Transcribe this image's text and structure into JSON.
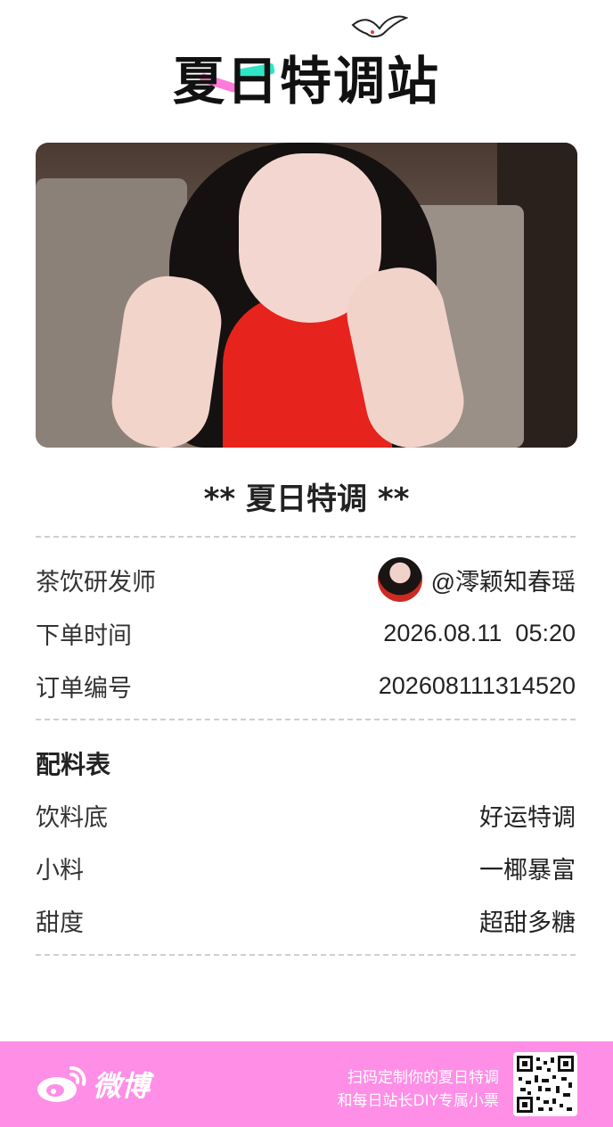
{
  "logo": {
    "text": "夏日特调站"
  },
  "receipt": {
    "title": "** 夏日特调 **",
    "maker_label": "茶饮研发师",
    "maker_value": "@澪颖知春瑶",
    "time_label": "下单时间",
    "time_value": "2026.08.11  05:20",
    "order_label": "订单编号",
    "order_value": "202608111314520"
  },
  "ingredients": {
    "title": "配料表",
    "items": [
      {
        "label": "饮料底",
        "value": "好运特调"
      },
      {
        "label": "小料",
        "value": "一椰暴富"
      },
      {
        "label": "甜度",
        "value": "超甜多糖"
      }
    ]
  },
  "footer": {
    "brand": "微博",
    "line1": "扫码定制你的夏日特调",
    "line2": "和每日站长DIY专属小票"
  },
  "colors": {
    "footer_bg": "#ff8ee6",
    "accent_pink": "#ff7ad9",
    "accent_green": "#2fe6c4"
  },
  "icons": [
    "bird-icon",
    "weibo-icon",
    "qr-code"
  ]
}
